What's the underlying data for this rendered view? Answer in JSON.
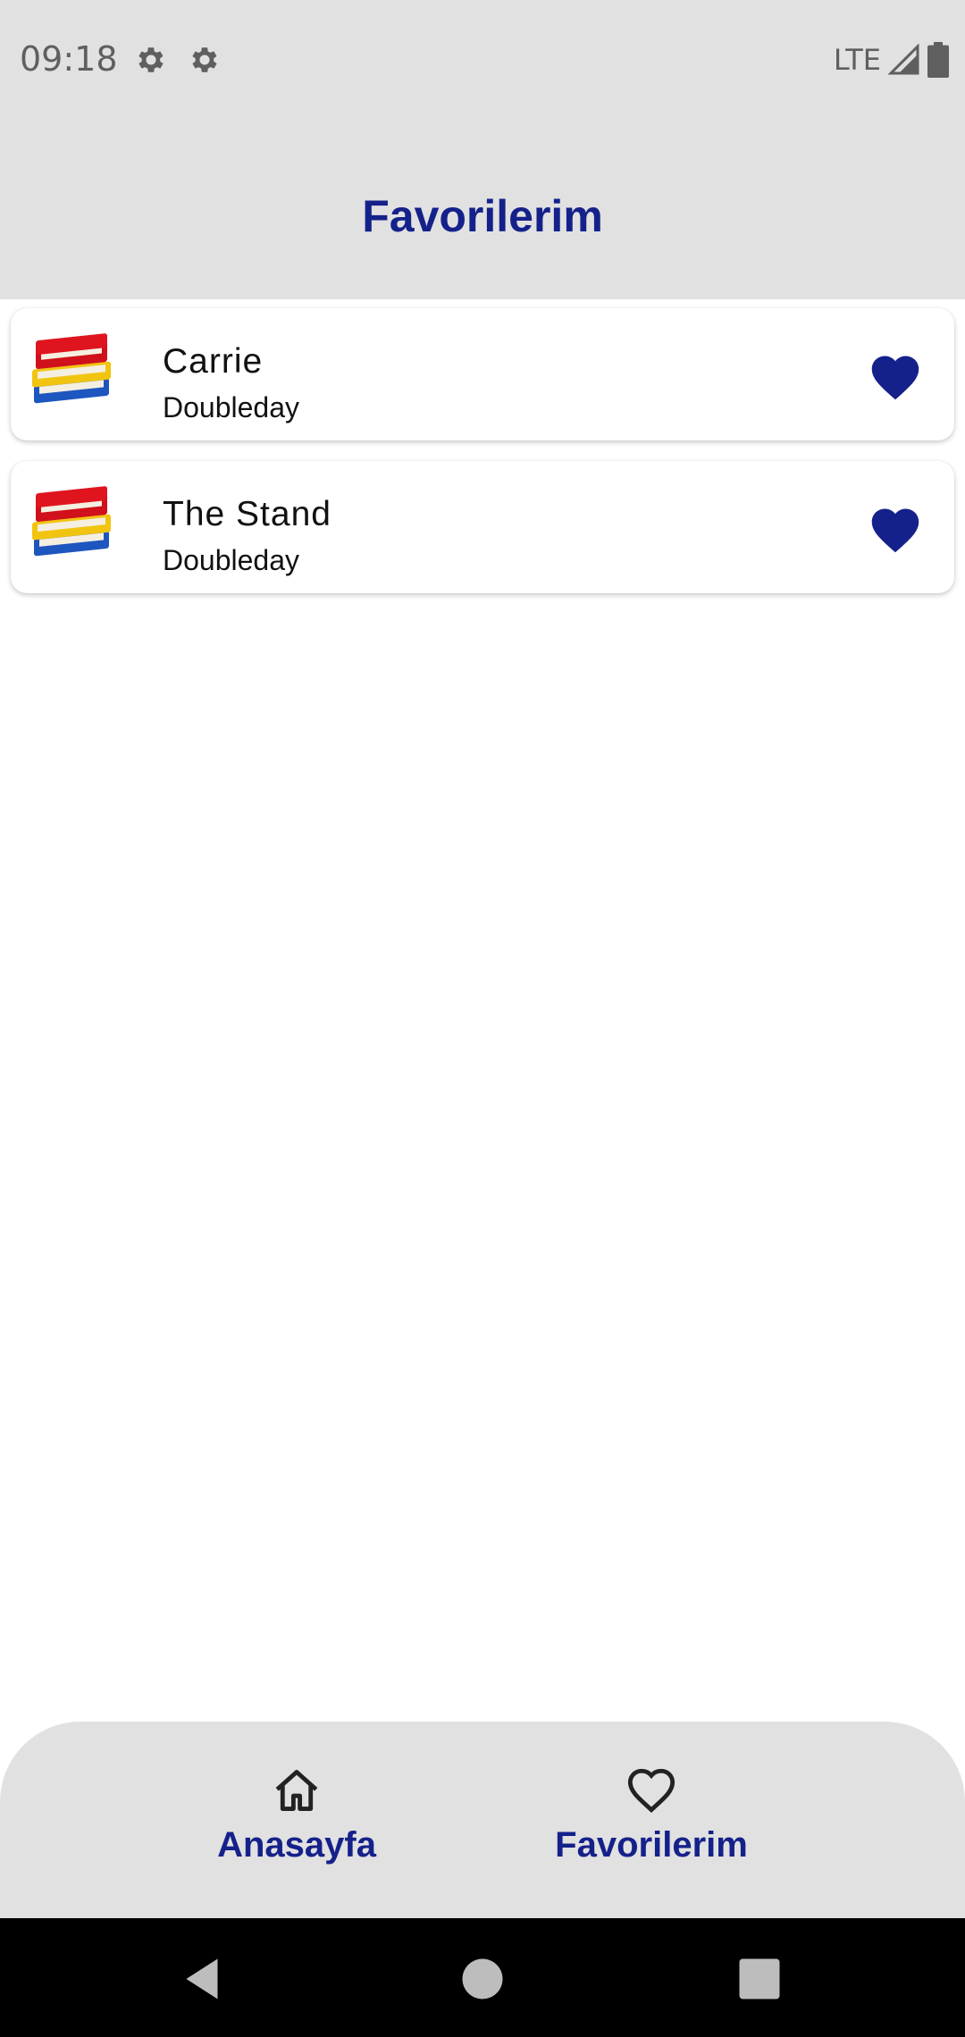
{
  "status_bar": {
    "time": "09:18",
    "network": "LTE",
    "icons": [
      "gear-icon",
      "gear-icon",
      "signal-icon",
      "battery-icon"
    ]
  },
  "app_bar": {
    "title": "Favorilerim"
  },
  "favorites": [
    {
      "title": "Carrie",
      "publisher": "Doubleday",
      "thumbnail": "books-icon",
      "favorite_icon": "heart-filled-icon"
    },
    {
      "title": "The Stand",
      "publisher": "Doubleday",
      "thumbnail": "books-icon",
      "favorite_icon": "heart-filled-icon"
    }
  ],
  "bottom_nav": {
    "items": [
      {
        "label": "Anasayfa",
        "icon": "home-icon"
      },
      {
        "label": "Favorilerim",
        "icon": "heart-outline-icon"
      }
    ]
  },
  "system_nav": {
    "icons": [
      "back-icon",
      "home-circle-icon",
      "recents-icon"
    ]
  },
  "colors": {
    "accent": "#15218a",
    "bar_background": "#e1e1e1",
    "background": "#ffffff"
  }
}
